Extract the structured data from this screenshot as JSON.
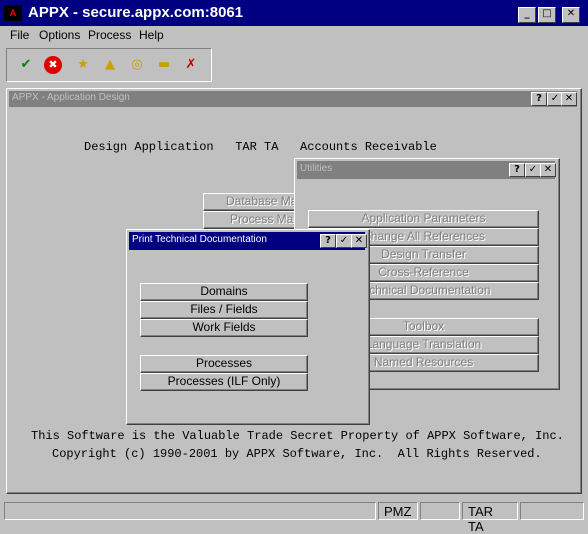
{
  "window": {
    "title": "APPX - secure.appx.com:8061",
    "controls": {
      "minimize": "_",
      "maximize": "□",
      "close": "✕"
    }
  },
  "menu": [
    "File",
    "Options",
    "Process",
    "Help"
  ],
  "toolbar": {
    "icons": [
      "check-icon",
      "stop-icon",
      "folder-star-icon",
      "folder-up-icon",
      "folder-search-icon",
      "folder-close-icon",
      "folder-x-icon"
    ]
  },
  "design_window": {
    "title": "APPX - Application Design",
    "header": "Design Application   TAR TA   Accounts Receivable",
    "footer_line1": "This Software is the Valuable Trade Secret Property of APPX Software, Inc.",
    "footer_line2": "Copyright (c) 1990-2001 by APPX Software, Inc.  All Rights Reserved.",
    "background_buttons": [
      "Database Management",
      "Process Management"
    ]
  },
  "utilities": {
    "title": "Utilities",
    "buttons": [
      "Application Parameters",
      "Change All References",
      "Design Transfer",
      "Cross-Reference",
      "Technical Documentation",
      "Toolbox",
      "Language Translation",
      "Named Resources"
    ]
  },
  "print_dialog": {
    "title": "Print Technical Documentation",
    "buttons": [
      "Domains",
      "Files / Fields",
      "Work Fields",
      "Processes",
      "Processes (ILF Only)"
    ]
  },
  "statusbar": [
    "",
    "PMZ",
    "",
    "TAR TA",
    ""
  ]
}
